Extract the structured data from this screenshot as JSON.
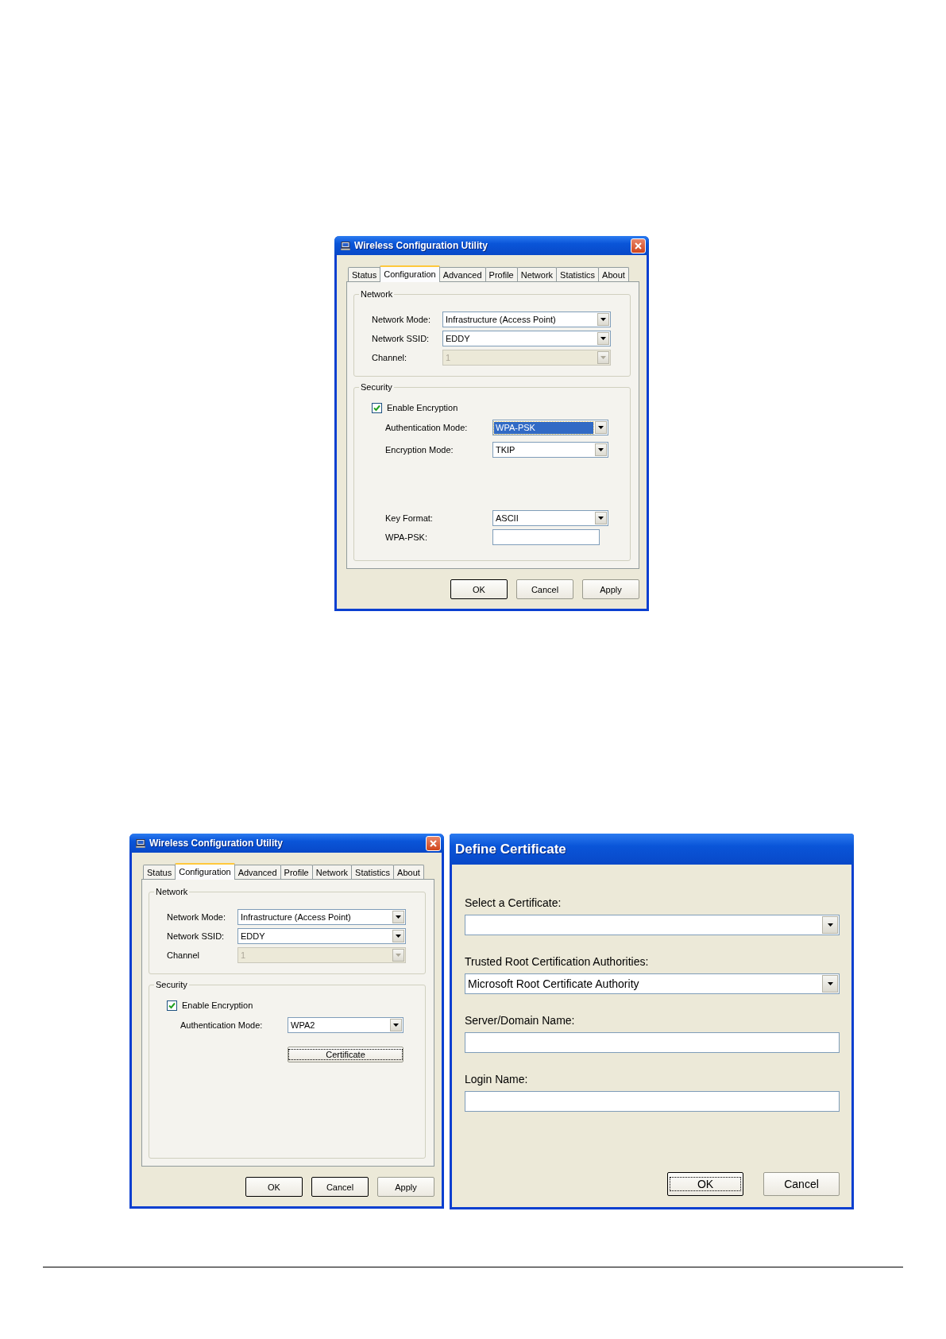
{
  "dialogs": [
    {
      "kind": "wireless",
      "title": "Wireless Configuration Utility",
      "tabs": [
        {
          "label": "Status",
          "selected": false
        },
        {
          "label": "Configuration",
          "selected": true
        },
        {
          "label": "Advanced",
          "selected": false
        },
        {
          "label": "Profile",
          "selected": false
        },
        {
          "label": "Network",
          "selected": false
        },
        {
          "label": "Statistics",
          "selected": false
        },
        {
          "label": "About",
          "selected": false
        }
      ],
      "network": {
        "title": "Network",
        "fields": [
          {
            "label": "Network Mode:",
            "value": "Infrastructure (Access Point)",
            "disabled": false
          },
          {
            "label": "Network SSID:",
            "value": "EDDY",
            "disabled": false
          },
          {
            "label": "Channel:",
            "value": "1",
            "disabled": true
          }
        ]
      },
      "security": {
        "title": "Security",
        "encryption": {
          "label": "Enable Encryption",
          "checked": true
        },
        "items": [
          {
            "kind": "dropdown",
            "label": "Authentication Mode:",
            "value": "WPA-PSK",
            "focused": true
          },
          {
            "kind": "dropdown",
            "label": "Encryption Mode:",
            "value": "TKIP",
            "focused": false
          },
          {
            "kind": "dropdown",
            "label": "Key Format:",
            "value": "ASCII",
            "focused": false
          },
          {
            "kind": "text",
            "label": "WPA-PSK:"
          }
        ]
      },
      "buttons": [
        {
          "label": "OK",
          "default": true,
          "focused": false
        },
        {
          "label": "Cancel",
          "default": false,
          "focused": false
        },
        {
          "label": "Apply",
          "default": false,
          "focused": false
        }
      ]
    },
    {
      "kind": "wireless",
      "title": "Wireless Configuration Utility",
      "tabs": [
        {
          "label": "Status",
          "selected": false
        },
        {
          "label": "Configuration",
          "selected": true
        },
        {
          "label": "Advanced",
          "selected": false
        },
        {
          "label": "Profile",
          "selected": false
        },
        {
          "label": "Network",
          "selected": false
        },
        {
          "label": "Statistics",
          "selected": false
        },
        {
          "label": "About",
          "selected": false
        }
      ],
      "network": {
        "title": "Network",
        "fields": [
          {
            "label": "Network Mode:",
            "value": "Infrastructure (Access Point)",
            "disabled": false
          },
          {
            "label": "Network SSID:",
            "value": "EDDY",
            "disabled": false
          },
          {
            "label": "Channel",
            "value": "1",
            "disabled": true
          }
        ]
      },
      "security": {
        "title": "Security",
        "encryption": {
          "label": "Enable Encryption",
          "checked": true
        },
        "items": [
          {
            "kind": "dropdown",
            "label": "Authentication Mode:",
            "value": "WPA2",
            "focused": false
          },
          {
            "kind": "button",
            "label": "Certificate",
            "focused": true
          }
        ]
      },
      "buttons": [
        {
          "label": "OK",
          "default": true,
          "focused": false
        },
        {
          "label": "Cancel",
          "default": true,
          "focused": false
        },
        {
          "label": "Apply",
          "default": false,
          "focused": false
        }
      ]
    },
    {
      "kind": "certificate",
      "title": "Define Certificate",
      "fields": [
        {
          "kind": "dropdown",
          "label": "Select a Certificate:"
        },
        {
          "kind": "dropdown",
          "label": "Trusted Root Certification Authorities:",
          "value": "Microsoft Root Certificate Authority"
        },
        {
          "kind": "text",
          "label": "Server/Domain Name:"
        },
        {
          "kind": "text",
          "label": "Login Name:"
        }
      ],
      "buttons": [
        {
          "label": "OK",
          "default": true,
          "focused": true
        },
        {
          "label": "Cancel",
          "default": false,
          "focused": false
        }
      ]
    }
  ]
}
